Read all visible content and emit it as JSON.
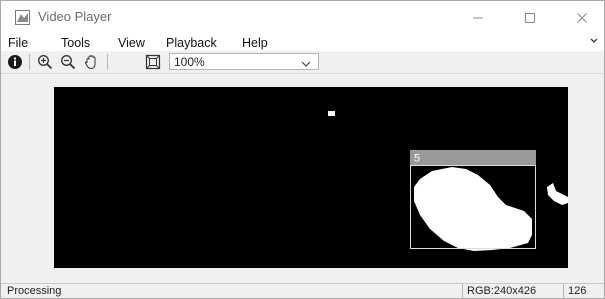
{
  "window": {
    "title": "Video Player",
    "icon": "matlab-icon",
    "controls": {
      "minimize_icon": "minimize-icon",
      "maximize_icon": "maximize-icon",
      "close_icon": "close-icon"
    }
  },
  "menubar": {
    "items": [
      "File",
      "Tools",
      "View",
      "Playback",
      "Help"
    ],
    "overflow_icon": "chevron-icon"
  },
  "toolbar": {
    "icons": [
      "info-icon",
      "zoom-in-icon",
      "zoom-out-icon",
      "pan-hand-icon",
      "fit-to-window-icon"
    ],
    "zoom": {
      "value": "100%",
      "dropdown_icon": "chevron-down-icon"
    }
  },
  "video": {
    "overlay_label": "5",
    "background_color": "#000000",
    "blob_color": "#ffffff",
    "label_bar_color": "#9a9a9a"
  },
  "statusbar": {
    "text": "Processing",
    "image_info": "RGB:240x426",
    "frame_number": "126"
  }
}
